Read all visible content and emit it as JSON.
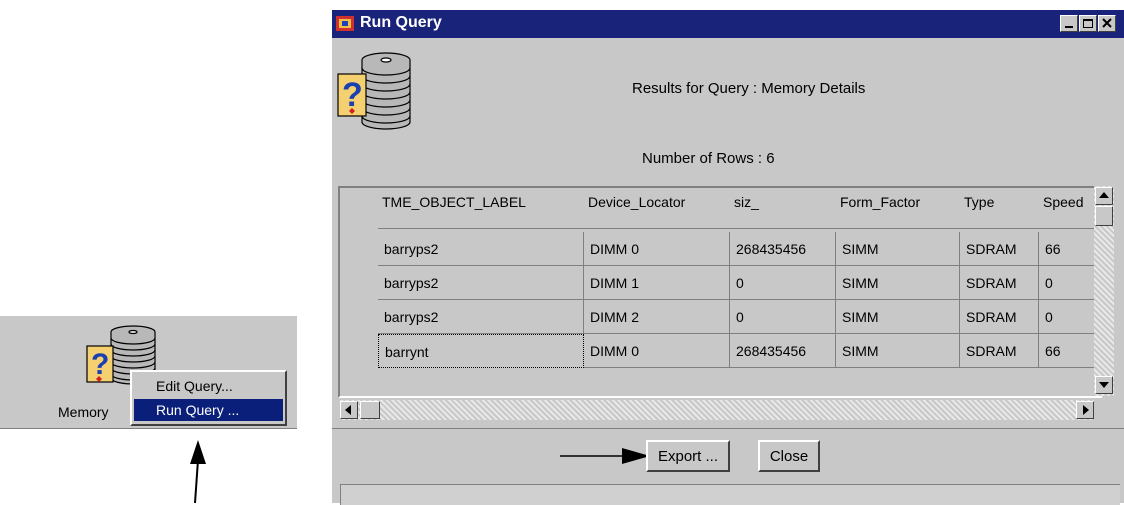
{
  "desktop": {
    "icon_label": "Memory",
    "context_menu": [
      {
        "label": "Edit Query...",
        "selected": false
      },
      {
        "label": "Run Query ...",
        "selected": true
      }
    ]
  },
  "window": {
    "title": "Run Query",
    "results_title": "Results for Query : Memory Details",
    "rows_label": "Number of Rows :  6",
    "columns": [
      "TME_OBJECT_LABEL",
      "Device_Locator",
      "siz_",
      "Form_Factor",
      "Type",
      "Speed"
    ],
    "rows": [
      [
        "barryps2",
        "DIMM 0",
        "268435456",
        "SIMM",
        "SDRAM",
        "66"
      ],
      [
        "barryps2",
        "DIMM 1",
        "0",
        "SIMM",
        "SDRAM",
        "0"
      ],
      [
        "barryps2",
        "DIMM 2",
        "0",
        "SIMM",
        "SDRAM",
        "0"
      ],
      [
        "barrynt",
        "DIMM 0",
        "268435456",
        "SIMM",
        "SDRAM",
        "66"
      ]
    ],
    "buttons": {
      "export": "Export ...",
      "close": "Close"
    }
  },
  "colors": {
    "titlebar": "#1a237a",
    "menu_highlight": "#0a1f7a",
    "face": "#c8c8c8"
  }
}
